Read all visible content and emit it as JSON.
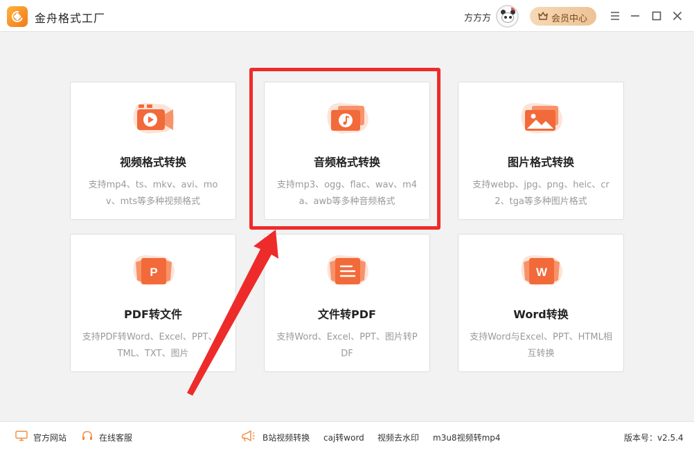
{
  "app": {
    "title": "金舟格式工厂"
  },
  "user": {
    "name": "方方方",
    "vip_label": "会员中心"
  },
  "cards": [
    {
      "name": "视频格式转换",
      "desc": "支持mp4、ts、mkv、avi、mov、mts等多种视频格式",
      "icon": "video-icon"
    },
    {
      "name": "音频格式转换",
      "desc": "支持mp3、ogg、flac、wav、m4a、awb等多种音频格式",
      "icon": "audio-icon"
    },
    {
      "name": "图片格式转换",
      "desc": "支持webp、jpg、png、heic、cr2、tga等多种图片格式",
      "icon": "image-icon"
    },
    {
      "name": "PDF转文件",
      "desc": "支持PDF转Word、Excel、PPT、HTML、TXT、图片",
      "icon": "pdf-icon"
    },
    {
      "name": "文件转PDF",
      "desc": "支持Word、Excel、PPT、图片转PDF",
      "icon": "doc-icon"
    },
    {
      "name": "Word转换",
      "desc": "支持Word与Excel、PPT、HTML相互转换",
      "icon": "word-icon"
    }
  ],
  "footer": {
    "website": "官方网站",
    "service": "在线客服",
    "links": [
      "B站视频转换",
      "caj转word",
      "视频去水印",
      "m3u8视频转mp4"
    ],
    "version": "版本号：v2.5.4"
  },
  "colors": {
    "accent": "#f26a3a",
    "annotation": "#ee2b2b",
    "vip": "#edc295"
  }
}
